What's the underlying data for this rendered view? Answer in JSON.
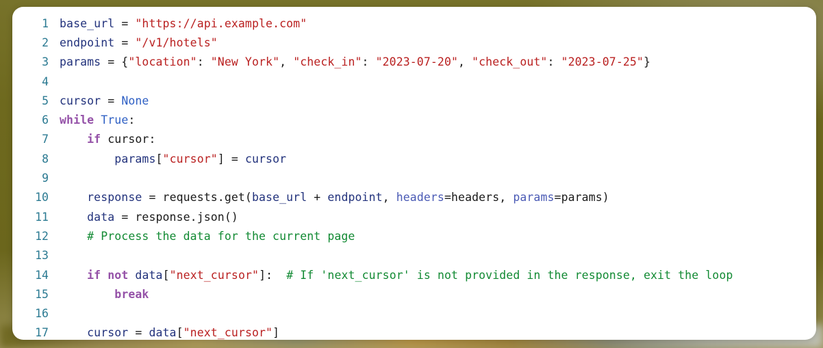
{
  "theme": {
    "page_background": "#6e691e",
    "card_background": "#ffffff",
    "line_number_color": "#2b7a92",
    "token_colors": {
      "variable": "#22327c",
      "string": "#ba2121",
      "keyword": "#9552a8",
      "builtin": "#2f60c4",
      "comment": "#128a33",
      "operator": "#1a1a1a",
      "plain": "#1a1a1a",
      "keyword_argument": "#4a5ab5"
    }
  },
  "code_block": {
    "language": "python",
    "first_line_number": 1,
    "last_line_number": 17,
    "lines": [
      {
        "number": "1",
        "tokens": [
          {
            "text": "base_url",
            "type": "variable"
          },
          {
            "text": " = ",
            "type": "operator"
          },
          {
            "text": "\"https://api.example.com\"",
            "type": "string"
          }
        ]
      },
      {
        "number": "2",
        "tokens": [
          {
            "text": "endpoint",
            "type": "variable"
          },
          {
            "text": " = ",
            "type": "operator"
          },
          {
            "text": "\"/v1/hotels\"",
            "type": "string"
          }
        ]
      },
      {
        "number": "3",
        "tokens": [
          {
            "text": "params",
            "type": "variable"
          },
          {
            "text": " = {",
            "type": "operator"
          },
          {
            "text": "\"location\"",
            "type": "string"
          },
          {
            "text": ": ",
            "type": "operator"
          },
          {
            "text": "\"New York\"",
            "type": "string"
          },
          {
            "text": ", ",
            "type": "operator"
          },
          {
            "text": "\"check_in\"",
            "type": "string"
          },
          {
            "text": ": ",
            "type": "operator"
          },
          {
            "text": "\"2023-07-20\"",
            "type": "string"
          },
          {
            "text": ", ",
            "type": "operator"
          },
          {
            "text": "\"check_out\"",
            "type": "string"
          },
          {
            "text": ": ",
            "type": "operator"
          },
          {
            "text": "\"2023-07-25\"",
            "type": "string"
          },
          {
            "text": "}",
            "type": "operator"
          }
        ]
      },
      {
        "number": "4",
        "tokens": []
      },
      {
        "number": "5",
        "tokens": [
          {
            "text": "cursor",
            "type": "variable"
          },
          {
            "text": " = ",
            "type": "operator"
          },
          {
            "text": "None",
            "type": "builtin"
          }
        ]
      },
      {
        "number": "6",
        "tokens": [
          {
            "text": "while",
            "type": "keyword"
          },
          {
            "text": " ",
            "type": "plain"
          },
          {
            "text": "True",
            "type": "builtin"
          },
          {
            "text": ":",
            "type": "operator"
          }
        ]
      },
      {
        "number": "7",
        "tokens": [
          {
            "text": "    ",
            "type": "plain"
          },
          {
            "text": "if",
            "type": "keyword"
          },
          {
            "text": " ",
            "type": "plain"
          },
          {
            "text": "cursor",
            "type": "plain"
          },
          {
            "text": ":",
            "type": "operator"
          }
        ]
      },
      {
        "number": "8",
        "tokens": [
          {
            "text": "        ",
            "type": "plain"
          },
          {
            "text": "params",
            "type": "variable"
          },
          {
            "text": "[",
            "type": "operator"
          },
          {
            "text": "\"cursor\"",
            "type": "string"
          },
          {
            "text": "] = ",
            "type": "operator"
          },
          {
            "text": "cursor",
            "type": "variable"
          }
        ]
      },
      {
        "number": "9",
        "tokens": []
      },
      {
        "number": "10",
        "tokens": [
          {
            "text": "    ",
            "type": "plain"
          },
          {
            "text": "response",
            "type": "variable"
          },
          {
            "text": " = ",
            "type": "operator"
          },
          {
            "text": "requests.get(",
            "type": "plain"
          },
          {
            "text": "base_url",
            "type": "variable"
          },
          {
            "text": " + ",
            "type": "operator"
          },
          {
            "text": "endpoint",
            "type": "variable"
          },
          {
            "text": ", ",
            "type": "operator"
          },
          {
            "text": "headers",
            "type": "keyword_argument"
          },
          {
            "text": "=headers, ",
            "type": "operator"
          },
          {
            "text": "params",
            "type": "keyword_argument"
          },
          {
            "text": "=params)",
            "type": "operator"
          }
        ]
      },
      {
        "number": "11",
        "tokens": [
          {
            "text": "    ",
            "type": "plain"
          },
          {
            "text": "data",
            "type": "variable"
          },
          {
            "text": " = ",
            "type": "operator"
          },
          {
            "text": "response.json()",
            "type": "plain"
          }
        ]
      },
      {
        "number": "12",
        "tokens": [
          {
            "text": "    ",
            "type": "plain"
          },
          {
            "text": "# Process the data for the current page",
            "type": "comment"
          }
        ]
      },
      {
        "number": "13",
        "tokens": []
      },
      {
        "number": "14",
        "tokens": [
          {
            "text": "    ",
            "type": "plain"
          },
          {
            "text": "if",
            "type": "keyword"
          },
          {
            "text": " ",
            "type": "plain"
          },
          {
            "text": "not",
            "type": "keyword"
          },
          {
            "text": " ",
            "type": "plain"
          },
          {
            "text": "data",
            "type": "variable"
          },
          {
            "text": "[",
            "type": "operator"
          },
          {
            "text": "\"next_cursor\"",
            "type": "string"
          },
          {
            "text": "]:  ",
            "type": "operator"
          },
          {
            "text": "# If 'next_cursor' is not provided in the response, exit the loop",
            "type": "comment"
          }
        ]
      },
      {
        "number": "15",
        "tokens": [
          {
            "text": "        ",
            "type": "plain"
          },
          {
            "text": "break",
            "type": "keyword"
          }
        ]
      },
      {
        "number": "16",
        "tokens": []
      },
      {
        "number": "17",
        "tokens": [
          {
            "text": "    ",
            "type": "plain"
          },
          {
            "text": "cursor",
            "type": "variable"
          },
          {
            "text": " = ",
            "type": "operator"
          },
          {
            "text": "data",
            "type": "variable"
          },
          {
            "text": "[",
            "type": "operator"
          },
          {
            "text": "\"next_cursor\"",
            "type": "string"
          },
          {
            "text": "]",
            "type": "operator"
          }
        ]
      }
    ]
  }
}
